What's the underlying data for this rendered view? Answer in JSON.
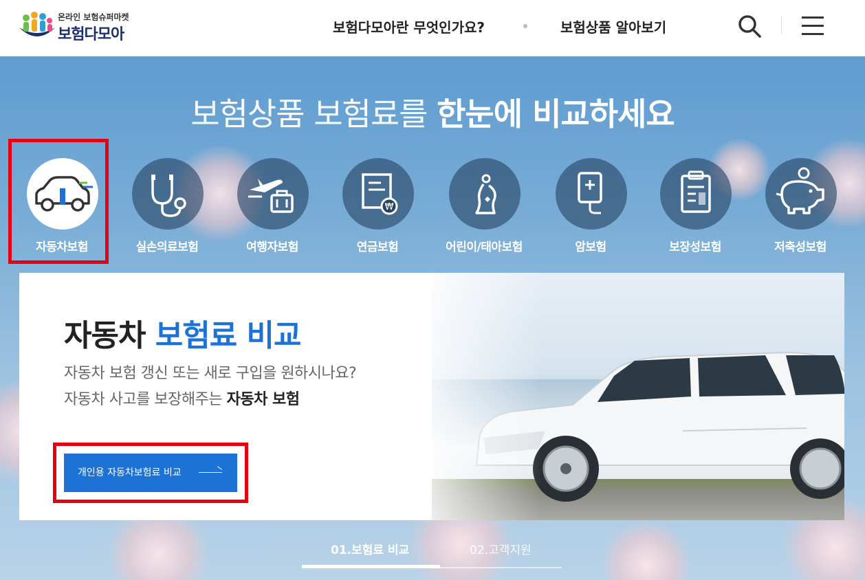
{
  "header": {
    "logo_sub": "온라인 보험슈퍼마켓",
    "logo_main": "보험다모아",
    "nav": [
      "보험다모아란 무엇인가요?",
      "보험상품 알아보기"
    ]
  },
  "hero": {
    "title_light": "보험상품 보험료를",
    "title_bold": "한눈에 비교하세요",
    "categories": [
      {
        "label": "자동차보험",
        "icon": "car-icon",
        "active": true
      },
      {
        "label": "실손의료보험",
        "icon": "stethoscope-icon",
        "active": false
      },
      {
        "label": "여행자보험",
        "icon": "airplane-luggage-icon",
        "active": false
      },
      {
        "label": "연금보험",
        "icon": "pension-document-icon",
        "active": false
      },
      {
        "label": "어린이/태아보험",
        "icon": "pregnant-woman-icon",
        "active": false
      },
      {
        "label": "암보험",
        "icon": "iv-bag-icon",
        "active": false
      },
      {
        "label": "보장성보험",
        "icon": "clipboard-icon",
        "active": false
      },
      {
        "label": "저축성보험",
        "icon": "piggy-bank-icon",
        "active": false
      }
    ]
  },
  "card": {
    "title_dark": "자동차",
    "title_blue": "보험료 비교",
    "desc_line1": "자동차 보험 갱신 또는 새로 구입을 원하시나요?",
    "desc_line2_pre": "자동차 사고를 보장해주는",
    "desc_line2_strong": "자동차 보험",
    "cta_label": "개인용 자동차보험료 비교"
  },
  "tabs": [
    {
      "label": "01.보험료 비교",
      "active": true
    },
    {
      "label": "02.고객지원",
      "active": false
    }
  ],
  "colors": {
    "accent": "#1d72d6",
    "highlight": "#e60012",
    "logo_navy": "#1a2f6b"
  }
}
